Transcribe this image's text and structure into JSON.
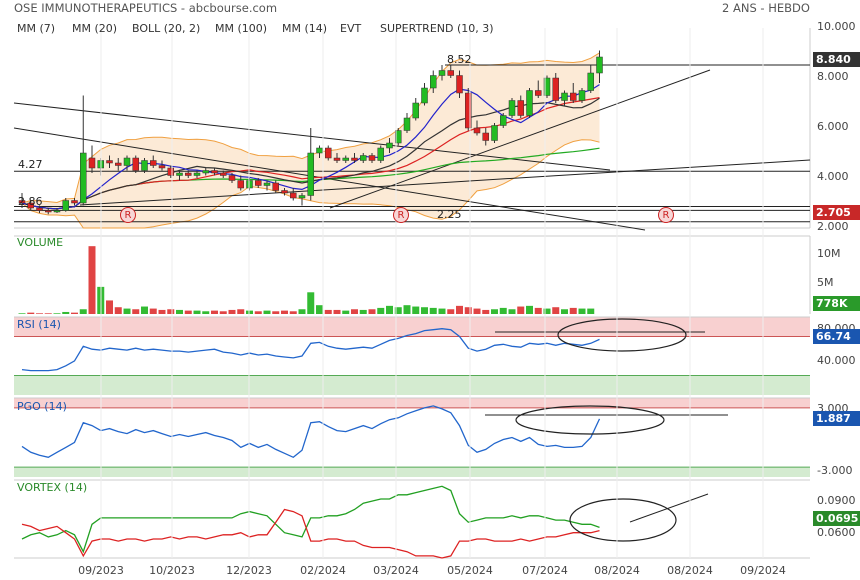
{
  "header": {
    "title": "OSE IMMUNOTHERAPEUTICS - abcbourse.com",
    "period": "2 ANS - HEBDO"
  },
  "legend": [
    {
      "label": "MM (7)",
      "color": "#2222cc"
    },
    {
      "label": "MM (20)",
      "color": "#dd2222"
    },
    {
      "label": "BOLL (20, 2)",
      "color": "#f0a040"
    },
    {
      "label": "MM (100)",
      "color": "#22aa22"
    },
    {
      "label": "MM (14)",
      "color": "#333333"
    },
    {
      "label": "EVT",
      "color": "#333333"
    },
    {
      "label": "SUPERTREND (10, 3)",
      "color": "#bb2222"
    }
  ],
  "panels": {
    "volume": "VOLUME",
    "rsi": "RSI (14)",
    "pgo": "PGO (14)",
    "vortex": "VORTEX (14)"
  },
  "badges": {
    "price": "8.840",
    "support": "2.705",
    "volume": "778K",
    "rsi": "66.74",
    "pgo": "1.887",
    "vortex": "0.0695"
  },
  "annotations": {
    "high": "8.52",
    "low": "2.25",
    "level_427": "4.27",
    "level_286": "2.86",
    "r_marker": "R"
  },
  "chart_data": {
    "type": "candlestick",
    "title": "OSE IMMUNOTHERAPEUTICS - abcbourse.com",
    "x_tick_labels": [
      "09/2023",
      "10/2023",
      "12/2023",
      "02/2024",
      "03/2024",
      "05/2024",
      "07/2024",
      "08/2024",
      "08/2024",
      "09/2024"
    ],
    "price_axis": {
      "ticks": [
        "10.000",
        "8.000",
        "6.000",
        "4.000",
        "2.000"
      ],
      "ylim": [
        2.0,
        10.0
      ],
      "scale": "linear"
    },
    "volume_axis": {
      "ticks": [
        "10M",
        "5M"
      ]
    },
    "rsi_axis": {
      "ticks": [
        "80.000",
        "40.000"
      ]
    },
    "pgo_axis": {
      "ticks": [
        "3.000",
        "-3.000"
      ]
    },
    "vortex_axis": {
      "ticks": [
        "0.0900",
        "0.0600"
      ]
    },
    "candles": [
      {
        "o": 3.1,
        "h": 3.4,
        "l": 2.8,
        "c": 3.0
      },
      {
        "o": 3.0,
        "h": 3.1,
        "l": 2.7,
        "c": 2.8
      },
      {
        "o": 2.8,
        "h": 2.9,
        "l": 2.6,
        "c": 2.7
      },
      {
        "o": 2.7,
        "h": 2.8,
        "l": 2.55,
        "c": 2.65
      },
      {
        "o": 2.65,
        "h": 2.8,
        "l": 2.6,
        "c": 2.7
      },
      {
        "o": 2.7,
        "h": 3.2,
        "l": 2.65,
        "c": 3.1
      },
      {
        "o": 3.1,
        "h": 3.2,
        "l": 2.9,
        "c": 3.0
      },
      {
        "o": 3.0,
        "h": 7.3,
        "l": 2.9,
        "c": 5.0
      },
      {
        "o": 4.8,
        "h": 5.3,
        "l": 4.2,
        "c": 4.4
      },
      {
        "o": 4.4,
        "h": 4.8,
        "l": 4.1,
        "c": 4.7
      },
      {
        "o": 4.7,
        "h": 4.9,
        "l": 4.4,
        "c": 4.6
      },
      {
        "o": 4.6,
        "h": 4.8,
        "l": 4.3,
        "c": 4.5
      },
      {
        "o": 4.5,
        "h": 4.9,
        "l": 4.3,
        "c": 4.8
      },
      {
        "o": 4.8,
        "h": 4.9,
        "l": 4.2,
        "c": 4.3
      },
      {
        "o": 4.3,
        "h": 4.8,
        "l": 4.2,
        "c": 4.7
      },
      {
        "o": 4.7,
        "h": 4.9,
        "l": 4.4,
        "c": 4.5
      },
      {
        "o": 4.5,
        "h": 4.7,
        "l": 4.3,
        "c": 4.4
      },
      {
        "o": 4.4,
        "h": 4.5,
        "l": 4.0,
        "c": 4.1
      },
      {
        "o": 4.1,
        "h": 4.3,
        "l": 3.9,
        "c": 4.2
      },
      {
        "o": 4.2,
        "h": 4.3,
        "l": 4.0,
        "c": 4.1
      },
      {
        "o": 4.1,
        "h": 4.3,
        "l": 4.0,
        "c": 4.2
      },
      {
        "o": 4.2,
        "h": 4.4,
        "l": 4.1,
        "c": 4.3
      },
      {
        "o": 4.3,
        "h": 4.4,
        "l": 4.1,
        "c": 4.2
      },
      {
        "o": 4.2,
        "h": 4.3,
        "l": 4.0,
        "c": 4.1
      },
      {
        "o": 4.1,
        "h": 4.2,
        "l": 3.8,
        "c": 3.9
      },
      {
        "o": 3.9,
        "h": 4.1,
        "l": 3.5,
        "c": 3.6
      },
      {
        "o": 3.6,
        "h": 4.0,
        "l": 3.5,
        "c": 3.9
      },
      {
        "o": 3.9,
        "h": 4.0,
        "l": 3.6,
        "c": 3.7
      },
      {
        "o": 3.7,
        "h": 3.9,
        "l": 3.5,
        "c": 3.8
      },
      {
        "o": 3.8,
        "h": 3.9,
        "l": 3.4,
        "c": 3.5
      },
      {
        "o": 3.5,
        "h": 3.6,
        "l": 3.3,
        "c": 3.4
      },
      {
        "o": 3.4,
        "h": 3.6,
        "l": 3.1,
        "c": 3.2
      },
      {
        "o": 3.2,
        "h": 3.4,
        "l": 2.9,
        "c": 3.3
      },
      {
        "o": 3.3,
        "h": 6.0,
        "l": 3.1,
        "c": 5.0
      },
      {
        "o": 5.0,
        "h": 5.3,
        "l": 4.8,
        "c": 5.2
      },
      {
        "o": 5.2,
        "h": 5.3,
        "l": 4.7,
        "c": 4.8
      },
      {
        "o": 4.8,
        "h": 5.0,
        "l": 4.6,
        "c": 4.7
      },
      {
        "o": 4.7,
        "h": 4.9,
        "l": 4.6,
        "c": 4.8
      },
      {
        "o": 4.8,
        "h": 5.0,
        "l": 4.6,
        "c": 4.7
      },
      {
        "o": 4.7,
        "h": 5.0,
        "l": 4.6,
        "c": 4.9
      },
      {
        "o": 4.9,
        "h": 5.0,
        "l": 4.6,
        "c": 4.7
      },
      {
        "o": 4.7,
        "h": 5.3,
        "l": 4.6,
        "c": 5.2
      },
      {
        "o": 5.2,
        "h": 5.6,
        "l": 5.0,
        "c": 5.4
      },
      {
        "o": 5.4,
        "h": 6.0,
        "l": 5.3,
        "c": 5.9
      },
      {
        "o": 5.9,
        "h": 6.6,
        "l": 5.8,
        "c": 6.4
      },
      {
        "o": 6.4,
        "h": 7.2,
        "l": 6.3,
        "c": 7.0
      },
      {
        "o": 7.0,
        "h": 7.8,
        "l": 6.9,
        "c": 7.6
      },
      {
        "o": 7.6,
        "h": 8.3,
        "l": 7.4,
        "c": 8.1
      },
      {
        "o": 8.1,
        "h": 8.52,
        "l": 7.9,
        "c": 8.3
      },
      {
        "o": 8.3,
        "h": 8.5,
        "l": 8.0,
        "c": 8.1
      },
      {
        "o": 8.1,
        "h": 8.3,
        "l": 7.2,
        "c": 7.4
      },
      {
        "o": 7.4,
        "h": 7.6,
        "l": 5.9,
        "c": 6.0
      },
      {
        "o": 6.0,
        "h": 6.3,
        "l": 5.7,
        "c": 5.8
      },
      {
        "o": 5.8,
        "h": 6.0,
        "l": 5.3,
        "c": 5.5
      },
      {
        "o": 5.5,
        "h": 6.2,
        "l": 5.4,
        "c": 6.1
      },
      {
        "o": 6.1,
        "h": 6.6,
        "l": 6.0,
        "c": 6.5
      },
      {
        "o": 6.5,
        "h": 7.2,
        "l": 6.4,
        "c": 7.1
      },
      {
        "o": 7.1,
        "h": 7.3,
        "l": 6.4,
        "c": 6.5
      },
      {
        "o": 6.5,
        "h": 7.6,
        "l": 6.4,
        "c": 7.5
      },
      {
        "o": 7.5,
        "h": 7.9,
        "l": 7.2,
        "c": 7.3
      },
      {
        "o": 7.3,
        "h": 8.1,
        "l": 7.2,
        "c": 8.0
      },
      {
        "o": 8.0,
        "h": 8.2,
        "l": 7.0,
        "c": 7.1
      },
      {
        "o": 7.1,
        "h": 7.5,
        "l": 6.9,
        "c": 7.4
      },
      {
        "o": 7.4,
        "h": 7.8,
        "l": 7.0,
        "c": 7.1
      },
      {
        "o": 7.1,
        "h": 7.6,
        "l": 7.0,
        "c": 7.5
      },
      {
        "o": 7.5,
        "h": 8.5,
        "l": 7.4,
        "c": 8.2
      },
      {
        "o": 8.2,
        "h": 9.1,
        "l": 7.8,
        "c": 8.84
      }
    ],
    "volume_millions": [
      0.1,
      0.2,
      0.1,
      0.1,
      0.1,
      0.3,
      0.2,
      0.7,
      10.0,
      4.0,
      2.0,
      1.0,
      0.8,
      0.7,
      1.1,
      0.8,
      0.6,
      0.7,
      0.6,
      0.5,
      0.5,
      0.4,
      0.5,
      0.4,
      0.6,
      0.7,
      0.5,
      0.4,
      0.5,
      0.4,
      0.5,
      0.4,
      0.7,
      3.2,
      1.3,
      0.6,
      0.6,
      0.5,
      0.7,
      0.6,
      0.7,
      0.9,
      1.2,
      1.0,
      1.3,
      1.1,
      1.0,
      0.9,
      0.8,
      0.7,
      1.2,
      1.0,
      0.8,
      0.6,
      0.7,
      0.9,
      0.7,
      1.1,
      1.2,
      0.9,
      0.8,
      1.0,
      0.7,
      0.9,
      0.8,
      0.8
    ],
    "rsi": [
      36,
      35,
      35,
      35,
      36,
      40,
      45,
      60,
      57,
      56,
      58,
      57,
      56,
      58,
      56,
      57,
      56,
      55,
      55,
      54,
      55,
      56,
      57,
      54,
      53,
      51,
      53,
      51,
      52,
      50,
      49,
      48,
      50,
      63,
      64,
      60,
      58,
      57,
      58,
      59,
      58,
      62,
      66,
      68,
      71,
      73,
      76,
      77,
      78,
      77,
      70,
      58,
      55,
      57,
      61,
      62,
      60,
      59,
      63,
      62,
      63,
      61,
      63,
      62,
      61,
      63,
      67
    ],
    "pgo": [
      -0.9,
      -1.5,
      -1.8,
      -2.0,
      -1.5,
      -1.0,
      -0.5,
      1.5,
      1.2,
      0.7,
      0.9,
      0.6,
      0.4,
      0.8,
      0.5,
      0.7,
      0.4,
      0.1,
      0.3,
      0.1,
      0.3,
      0.5,
      0.2,
      0.0,
      -0.3,
      -1.0,
      -0.6,
      -1.0,
      -0.7,
      -1.2,
      -1.6,
      -2.0,
      -1.3,
      1.5,
      1.6,
      1.1,
      0.7,
      0.6,
      0.9,
      1.2,
      0.9,
      1.4,
      1.8,
      2.0,
      2.4,
      2.7,
      3.0,
      3.2,
      2.9,
      2.5,
      1.2,
      -0.8,
      -1.5,
      -1.2,
      -0.6,
      -0.2,
      0.0,
      -0.4,
      0.0,
      -0.7,
      -0.9,
      -0.8,
      -1.0,
      -1.0,
      -0.9,
      0.0,
      1.887
    ],
    "vortex_plus": [
      0.064,
      0.066,
      0.067,
      0.065,
      0.066,
      0.068,
      0.066,
      0.058,
      0.071,
      0.074,
      0.074,
      0.074,
      0.074,
      0.074,
      0.074,
      0.074,
      0.074,
      0.074,
      0.074,
      0.074,
      0.074,
      0.074,
      0.074,
      0.074,
      0.074,
      0.076,
      0.077,
      0.076,
      0.075,
      0.071,
      0.067,
      0.066,
      0.065,
      0.074,
      0.074,
      0.075,
      0.075,
      0.076,
      0.078,
      0.081,
      0.082,
      0.083,
      0.083,
      0.085,
      0.085,
      0.086,
      0.087,
      0.088,
      0.089,
      0.087,
      0.076,
      0.072,
      0.073,
      0.074,
      0.074,
      0.074,
      0.075,
      0.074,
      0.075,
      0.075,
      0.074,
      0.073,
      0.073,
      0.072,
      0.071,
      0.071,
      0.0695
    ],
    "vortex_minus": [
      0.071,
      0.07,
      0.068,
      0.069,
      0.07,
      0.067,
      0.064,
      0.056,
      0.063,
      0.064,
      0.064,
      0.063,
      0.064,
      0.064,
      0.063,
      0.064,
      0.064,
      0.065,
      0.064,
      0.065,
      0.065,
      0.064,
      0.065,
      0.066,
      0.066,
      0.067,
      0.065,
      0.066,
      0.066,
      0.072,
      0.078,
      0.077,
      0.075,
      0.063,
      0.063,
      0.064,
      0.064,
      0.063,
      0.063,
      0.061,
      0.06,
      0.06,
      0.06,
      0.059,
      0.058,
      0.056,
      0.056,
      0.056,
      0.055,
      0.056,
      0.063,
      0.063,
      0.064,
      0.064,
      0.063,
      0.063,
      0.063,
      0.064,
      0.063,
      0.064,
      0.065,
      0.065,
      0.066,
      0.067,
      0.067,
      0.067,
      0.068
    ],
    "indicator_bands": {
      "rsi": {
        "overbought": 70,
        "oversold": 30
      },
      "pgo": {
        "upper": 3,
        "lower": -3
      }
    },
    "vortex_ylim": [
      0.055,
      0.092
    ]
  }
}
